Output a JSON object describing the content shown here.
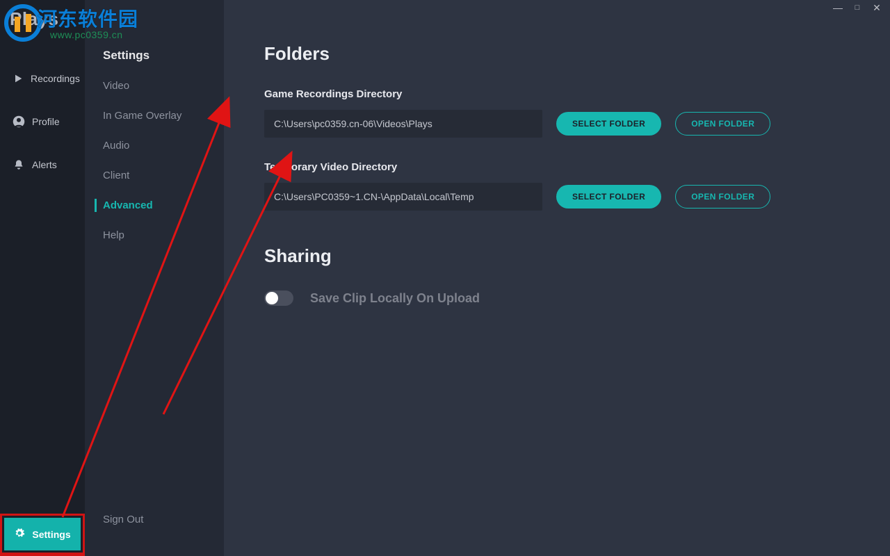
{
  "watermark": {
    "site_cn": "河东软件园",
    "site_url": "www.pc0359.cn"
  },
  "brand": {
    "name": "Plays"
  },
  "nav": {
    "recordings": "Recordings",
    "profile": "Profile",
    "alerts": "Alerts",
    "settings": "Settings"
  },
  "settings": {
    "heading": "Settings",
    "items": [
      {
        "label": "Video",
        "id": "video"
      },
      {
        "label": "In Game Overlay",
        "id": "overlay"
      },
      {
        "label": "Audio",
        "id": "audio"
      },
      {
        "label": "Client",
        "id": "client"
      },
      {
        "label": "Advanced",
        "id": "advanced"
      },
      {
        "label": "Help",
        "id": "help"
      }
    ],
    "active": "advanced",
    "sign_out": "Sign Out"
  },
  "main": {
    "folders_heading": "Folders",
    "game_dir_label": "Game Recordings Directory",
    "game_dir_value": "C:\\Users\\pc0359.cn-06\\Videos\\Plays",
    "temp_dir_label": "Temporary Video Directory",
    "temp_dir_value": "C:\\Users\\PC0359~1.CN-\\AppData\\Local\\Temp",
    "select_folder": "SELECT FOLDER",
    "open_folder": "OPEN FOLDER",
    "sharing_heading": "Sharing",
    "save_clip_label": "Save Clip Locally On Upload",
    "save_clip_on": false
  },
  "window_controls": {
    "min": "—",
    "max": "□",
    "close": "✕"
  }
}
